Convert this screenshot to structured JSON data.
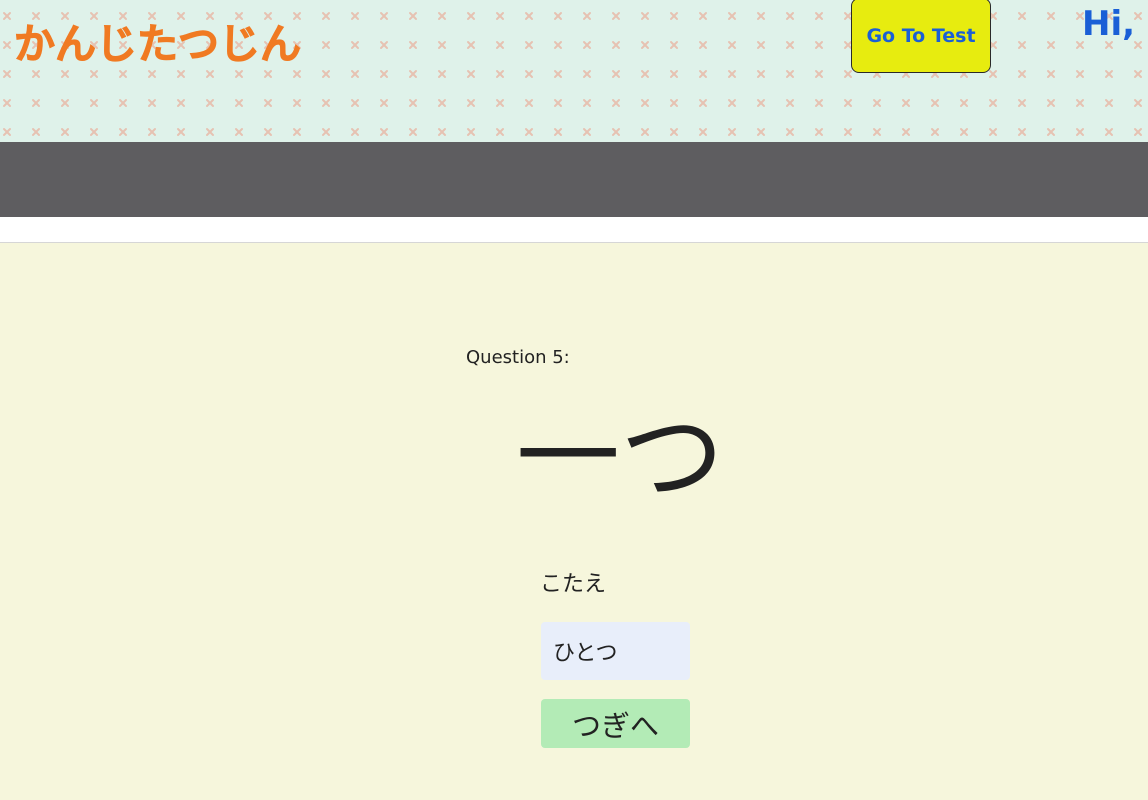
{
  "header": {
    "logo_text": "かんじたつじん",
    "goto_test_label": "Go To Test",
    "greeting_text": "Hi, "
  },
  "quiz": {
    "question_label": "Question 5:",
    "kanji": "一つ",
    "answer_label": "こたえ",
    "answer_value": "ひとつ",
    "next_label": "つぎへ"
  },
  "colors": {
    "header_bg": "#dff2ea",
    "pattern_x": "#e6c2b2",
    "logo": "#f07a22",
    "goto_button_bg": "#e7ec0f",
    "goto_button_text": "#1a5fd6",
    "greeting": "#1a5fd6",
    "navbar": "#5e5d60",
    "page_bg": "#f6f6dc",
    "input_bg": "#e8eefa",
    "next_button_bg": "#b3ebb6"
  }
}
